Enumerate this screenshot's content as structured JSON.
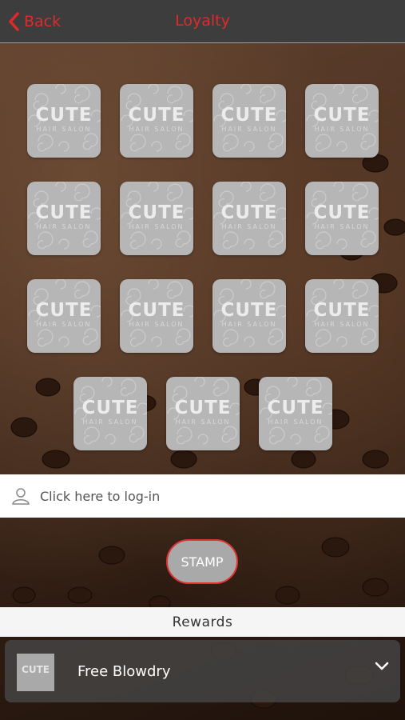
{
  "header": {
    "back_label": "Back",
    "title": "Loyalty"
  },
  "card": {
    "stamp_count": 15,
    "brand_text": "CUTE",
    "brand_sub": "HAIR SALON"
  },
  "login": {
    "label": "Click here to log-in"
  },
  "stamp_button": {
    "label": "STAMP"
  },
  "rewards": {
    "heading": "Rewards",
    "items": [
      {
        "label": "Free Blowdry",
        "thumb_text": "CUTE"
      }
    ]
  },
  "colors": {
    "accent": "#e02a2a",
    "header_bg": "#3d3d3d",
    "stamp_bg": "#b6b6b6"
  }
}
